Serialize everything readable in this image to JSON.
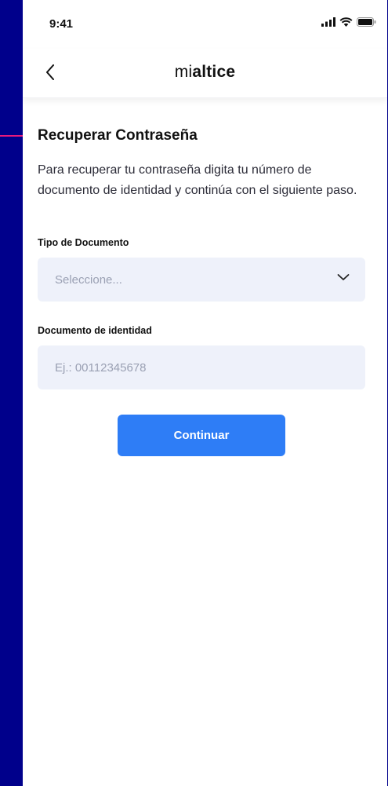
{
  "status_bar": {
    "time": "9:41"
  },
  "header": {
    "logo_light": "mi",
    "logo_bold": "altice"
  },
  "page": {
    "title": "Recuperar Contraseña",
    "description": "Para recuperar tu contraseña digita tu número de documento de identidad y continúa con el siguiente paso."
  },
  "form": {
    "doc_type": {
      "label": "Tipo de Documento",
      "placeholder": "Seleccione..."
    },
    "doc_id": {
      "label": "Documento de identidad",
      "placeholder": "Ej.: 00112345678"
    },
    "submit_label": "Continuar"
  },
  "colors": {
    "background": "#00008b",
    "primary_button": "#2e7df6",
    "field_bg": "#eef1fa",
    "annotation_arrow": "#e8197d"
  }
}
